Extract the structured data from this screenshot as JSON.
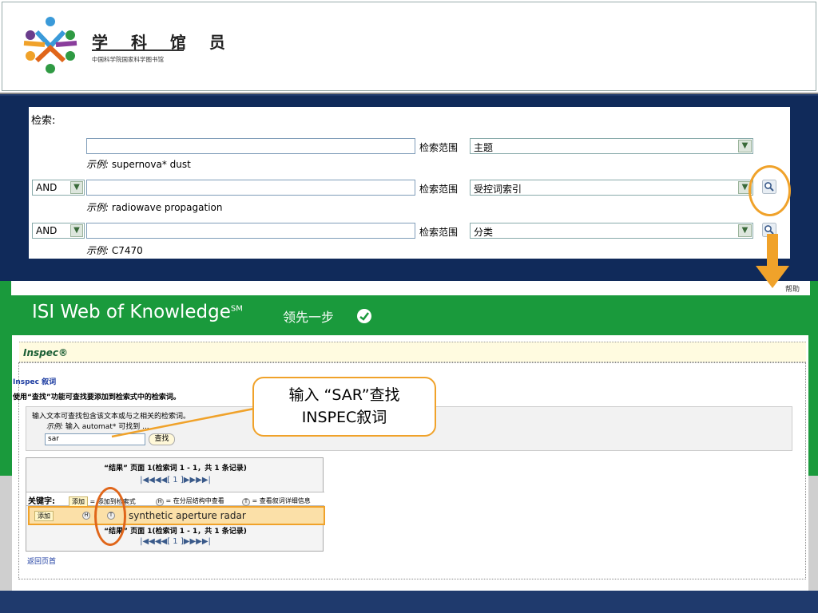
{
  "header": {
    "logo_title": "学 科 馆 员",
    "logo_subtitle": "中国科学院国家科学图书馆"
  },
  "search": {
    "label": "检索:",
    "scope_label": "检索范围",
    "rows": [
      {
        "operator": "",
        "example_prefix": "示例:",
        "example": "supernova* dust",
        "scope": "主题"
      },
      {
        "operator": "AND",
        "example_prefix": "示例:",
        "example": "radiowave propagation",
        "scope": "受控词索引"
      },
      {
        "operator": "AND",
        "example_prefix": "示例:",
        "example": "C7470",
        "scope": "分类"
      }
    ]
  },
  "isi": {
    "help": "帮助",
    "title": "ISI Web of Knowledge",
    "title_mark": "SM",
    "slogan": "领先一步",
    "section": "Inspec®",
    "thesaurus_title": "Inspec 叙词",
    "thesaurus_desc": "使用“查找”功能可查找要添加到检索式中的检索词。",
    "find_hint": "输入文本可查找包含该文本或与之相关的检索词。",
    "find_example_prefix": "示例:",
    "find_example": "输入 automat* 可找到 ...",
    "find_value": "sar",
    "find_button": "查找",
    "results_header": "“结果” 页面 1(检索词 1 - 1，共 1 条记录)",
    "pager": "|◀◀◀◀[ 1 ]▶▶▶▶|",
    "keyword_label": "关键字:",
    "legend_add_chip": "添加",
    "legend_add": "= 添加到检索式",
    "legend_h": "= 在分层结构中查看",
    "legend_t": "= 查看叙词详细信息",
    "row_add": "添加",
    "row_h": "H",
    "row_t": "T",
    "row_term": "synthetic aperture radar",
    "back": "返回页首"
  },
  "callout": {
    "line1": "输入 “SAR”查找",
    "line2": "INSPEC叙词"
  },
  "colors": {
    "highlight": "#f0a22a",
    "isi_green": "#1a9a3c",
    "navy": "#102a5a"
  }
}
